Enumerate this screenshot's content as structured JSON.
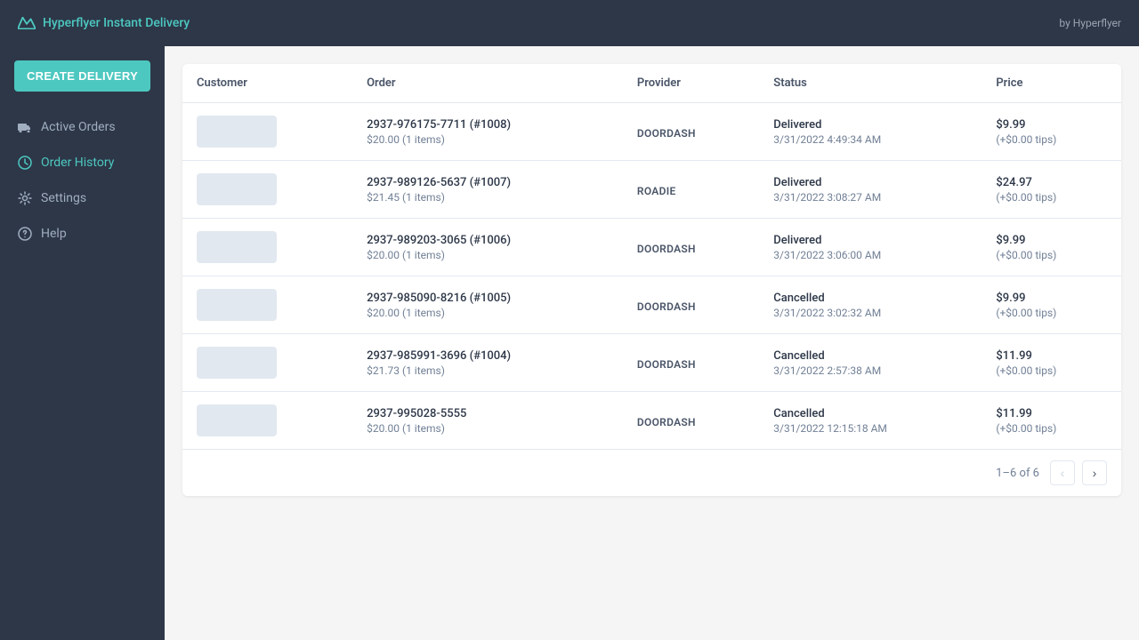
{
  "header": {
    "brand": "Hyperflyer Instant Delivery",
    "by": "by Hyperflyer"
  },
  "sidebar": {
    "create_button": "CREATE DELIVERY",
    "items": [
      {
        "id": "active-orders",
        "label": "Active Orders",
        "icon": "truck",
        "active": false
      },
      {
        "id": "order-history",
        "label": "Order History",
        "icon": "clock",
        "active": true
      },
      {
        "id": "settings",
        "label": "Settings",
        "icon": "gear",
        "active": false
      },
      {
        "id": "help",
        "label": "Help",
        "icon": "question",
        "active": false
      }
    ]
  },
  "table": {
    "columns": [
      "Customer",
      "Order",
      "Provider",
      "Status",
      "Price"
    ],
    "rows": [
      {
        "order_id": "2937-976175-7711 (#1008)",
        "order_amount": "$20.00 (1 items)",
        "provider": "DOORDASH",
        "status": "Delivered",
        "status_date": "3/31/2022 4:49:34 AM",
        "price": "$9.99",
        "tips": "(+$0.00 tips)"
      },
      {
        "order_id": "2937-989126-5637 (#1007)",
        "order_amount": "$21.45 (1 items)",
        "provider": "ROADIE",
        "status": "Delivered",
        "status_date": "3/31/2022 3:08:27 AM",
        "price": "$24.97",
        "tips": "(+$0.00 tips)"
      },
      {
        "order_id": "2937-989203-3065 (#1006)",
        "order_amount": "$20.00 (1 items)",
        "provider": "DOORDASH",
        "status": "Delivered",
        "status_date": "3/31/2022 3:06:00 AM",
        "price": "$9.99",
        "tips": "(+$0.00 tips)"
      },
      {
        "order_id": "2937-985090-8216 (#1005)",
        "order_amount": "$20.00 (1 items)",
        "provider": "DOORDASH",
        "status": "Cancelled",
        "status_date": "3/31/2022 3:02:32 AM",
        "price": "$9.99",
        "tips": "(+$0.00 tips)"
      },
      {
        "order_id": "2937-985991-3696 (#1004)",
        "order_amount": "$21.73 (1 items)",
        "provider": "DOORDASH",
        "status": "Cancelled",
        "status_date": "3/31/2022 2:57:38 AM",
        "price": "$11.99",
        "tips": "(+$0.00 tips)"
      },
      {
        "order_id": "2937-995028-5555",
        "order_amount": "$20.00 (1 items)",
        "provider": "DOORDASH",
        "status": "Cancelled",
        "status_date": "3/31/2022 12:15:18 AM",
        "price": "$11.99",
        "tips": "(+$0.00 tips)"
      }
    ],
    "pagination": {
      "info": "1–6 of 6",
      "prev_label": "‹",
      "next_label": "›"
    }
  }
}
